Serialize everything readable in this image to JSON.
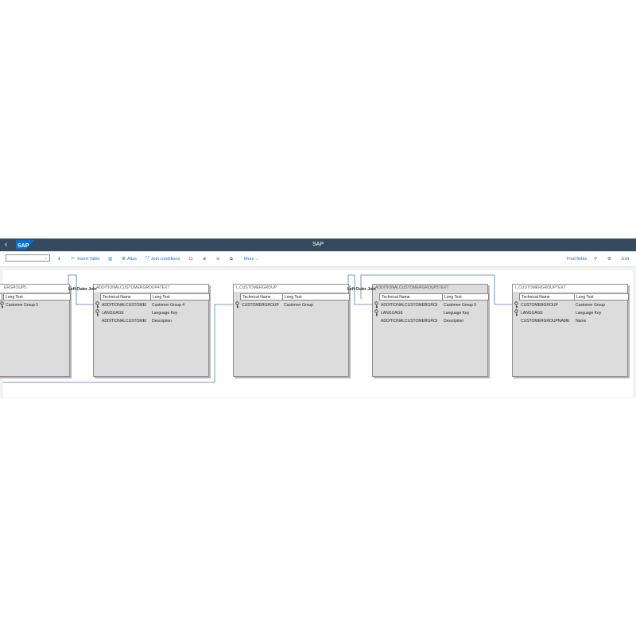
{
  "shell": {
    "back_label": "‹",
    "logo_text": "SAP",
    "title": "SAP"
  },
  "toolbar": {
    "select_value": "",
    "insert_table": "Insert Table",
    "alias": "Alias",
    "join_conditions": "Join conditions",
    "more": "More",
    "find_fields": "Find fields",
    "exit": "Exit"
  },
  "entities": [
    {
      "title": "ERGROUP5",
      "col_tn": "",
      "col_lt": "Long Text",
      "rows": [
        {
          "tn": "",
          "lt": "Customer Group 5",
          "key": true
        }
      ]
    },
    {
      "title": "ADDITIONALCUSTOMERGROUP4TEXT",
      "col_tn": "Technical Name",
      "col_lt": "Long Text",
      "rows": [
        {
          "tn": "ADDITIONALCUSTOMEI",
          "lt": "Customer Group 4",
          "key": true
        },
        {
          "tn": "LANGUAGE",
          "lt": "Language Key",
          "key": true
        },
        {
          "tn": "ADDITIONALCUSTOMEI",
          "lt": "Description",
          "key": false
        }
      ]
    },
    {
      "title": "I_CUSTOMERGROUP",
      "col_tn": "Technical Name",
      "col_lt": "Long Text",
      "rows": [
        {
          "tn": "CUSTOMERGROUP",
          "lt": "Customer Group",
          "key": true
        }
      ]
    },
    {
      "title": "ADDITIONALCUSTOMERGROUP5TEXT",
      "col_tn": "Technical Name",
      "col_lt": "Long Text",
      "rows": [
        {
          "tn": "ADDITIONALCUSTOMERGROI",
          "lt": "Customer Group 5",
          "key": true
        },
        {
          "tn": "LANGUAGE",
          "lt": "Language Key",
          "key": true
        },
        {
          "tn": "ADDITIONALCUSTOMERGROI",
          "lt": "Description",
          "key": false
        }
      ]
    },
    {
      "title": "I_CUSTOMERGROUPTEXT",
      "col_tn": "Technical Name",
      "col_lt": "Long Text",
      "rows": [
        {
          "tn": "CUSTOMERGROUP",
          "lt": "Customer Group",
          "key": true
        },
        {
          "tn": "LANGUAGE",
          "lt": "Language Key",
          "key": true
        },
        {
          "tn": "CUSTOMERGROUPNAME",
          "lt": "Name",
          "key": false
        }
      ]
    }
  ],
  "joins": [
    "Left Outer Join",
    "Left Outer Join"
  ]
}
